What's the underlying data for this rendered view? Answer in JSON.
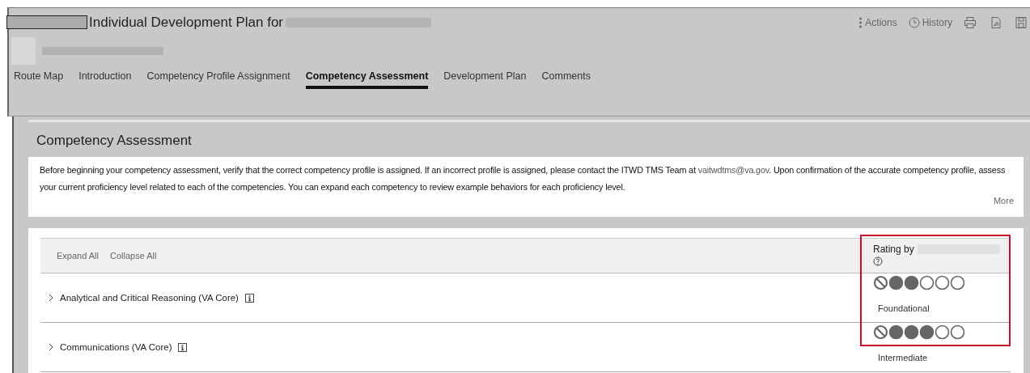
{
  "header": {
    "title": "Individual Development Plan for",
    "actions": [
      {
        "label": "Actions",
        "kind": "menu"
      },
      {
        "label": "History",
        "kind": "history"
      }
    ]
  },
  "tabs": [
    {
      "label": "Route Map",
      "selected": false
    },
    {
      "label": "Introduction",
      "selected": false
    },
    {
      "label": "Competency Profile Assignment",
      "selected": false
    },
    {
      "label": "Competency Assessment",
      "selected": true
    },
    {
      "label": "Development Plan",
      "selected": false
    },
    {
      "label": "Comments",
      "selected": false
    }
  ],
  "section": {
    "title": "Competency Assessment",
    "intro": "Before beginning your competency assessment, verify that the correct competency profile is assigned.  If an incorrect profile is assigned, please contact the ITWD TMS Team at ",
    "email": "vaitwdtms@va.gov",
    "intro_end": ". Upon confirmation of the accurate competency profile, assess your current proficiency level related to each of the competencies.  You can expand each competency to review example behaviors for each proficiency level.",
    "more": "More"
  },
  "table": {
    "expand_all": "Expand All",
    "collapse_all": "Collapse All",
    "rating_header": "Rating by",
    "rows": [
      {
        "name": "Analytical and Critical Reasoning (VA Core)",
        "stars": 2,
        "level_label": "Foundational"
      },
      {
        "name": "Communications (VA Core)",
        "stars": 3,
        "level_label": "Intermediate"
      }
    ]
  }
}
